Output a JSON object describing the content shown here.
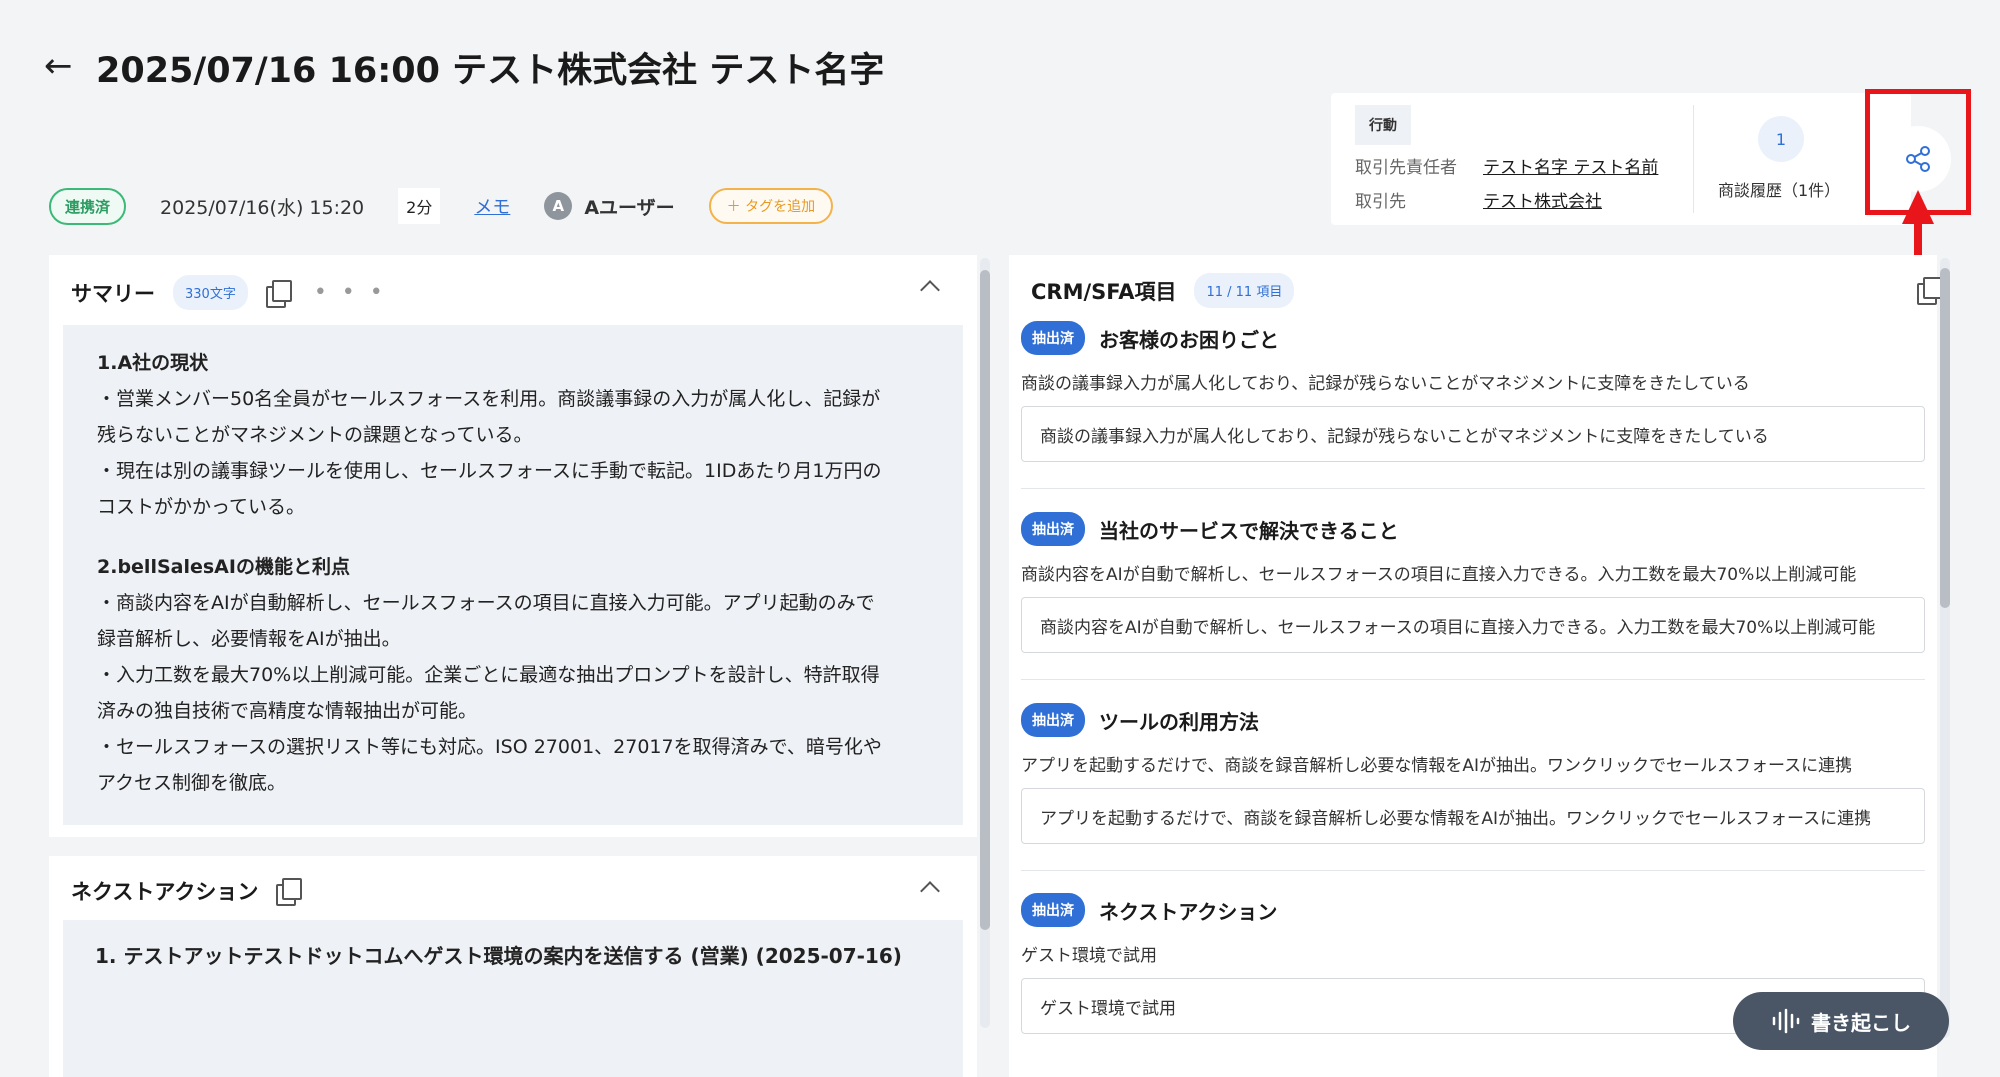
{
  "header": {
    "back_icon": "arrow-left-icon",
    "title": "2025/07/16 16:00 テスト株式会社 テスト名字"
  },
  "meta": {
    "status": "連携済",
    "datetime": "2025/07/16(水) 15:20",
    "duration": "2分",
    "memo": "メモ",
    "avatar_initial": "A",
    "user": "Aユーザー",
    "add_tag": "＋ タグを追加"
  },
  "info": {
    "action_label": "行動",
    "contact_key": "取引先責任者",
    "contact_value": "テスト名字 テスト名前",
    "account_key": "取引先",
    "account_value": "テスト株式会社",
    "history_count": "1",
    "history_label": "商談履歴（1件）"
  },
  "summary": {
    "title": "サマリー",
    "char_count": "330文字",
    "dots": "• • •",
    "sections": [
      {
        "heading": "1.A社の現状",
        "lines": [
          "・営業メンバー50名全員がセールスフォースを利用。商談議事録の入力が属人化し、記録が",
          "残らないことがマネジメントの課題となっている。",
          "・現在は別の議事録ツールを使用し、セールスフォースに手動で転記。1IDあたり月1万円の",
          "コストがかかっている。"
        ]
      },
      {
        "heading": "2.bellSalesAIの機能と利点",
        "lines": [
          "・商談内容をAIが自動解析し、セールスフォースの項目に直接入力可能。アプリ起動のみで",
          "録音解析し、必要情報をAIが抽出。",
          "・入力工数を最大70%以上削減可能。企業ごとに最適な抽出プロンプトを設計し、特許取得",
          "済みの独自技術で高精度な情報抽出が可能。",
          "・セールスフォースの選択リスト等にも対応。ISO 27001、27017を取得済みで、暗号化や",
          "アクセス制御を徹底。"
        ]
      }
    ]
  },
  "next_action": {
    "title": "ネクストアクション",
    "item": "1. テストアットテストドットコムへゲスト環境の案内を送信する (営業) (2025-07-16)"
  },
  "crm": {
    "title": "CRM/SFA項目",
    "count": "11 / 11 項目",
    "items": [
      {
        "chip": "抽出済",
        "label": "お客様のお困りごと",
        "desc": "商談の議事録入力が属人化しており、記録が残らないことがマネジメントに支障をきたしている",
        "value": "商談の議事録入力が属人化しており、記録が残らないことがマネジメントに支障をきたしている"
      },
      {
        "chip": "抽出済",
        "label": "当社のサービスで解決できること",
        "desc": "商談内容をAIが自動で解析し、セールスフォースの項目に直接入力できる。入力工数を最大70%以上削減可能",
        "value": "商談内容をAIが自動で解析し、セールスフォースの項目に直接入力できる。入力工数を最大70%以上削減可能"
      },
      {
        "chip": "抽出済",
        "label": "ツールの利用方法",
        "desc": "アプリを起動するだけで、商談を録音解析し必要な情報をAIが抽出。ワンクリックでセールスフォースに連携",
        "value": "アプリを起動するだけで、商談を録音解析し必要な情報をAIが抽出。ワンクリックでセールスフォースに連携"
      },
      {
        "chip": "抽出済",
        "label": "ネクストアクション",
        "desc": "ゲスト環境で試用",
        "value": "ゲスト環境で試用"
      }
    ]
  },
  "transcribe": {
    "label": "書き起こし"
  },
  "colors": {
    "accent": "#2f6fd6",
    "highlight": "#e8161b",
    "status_green": "#3cb878",
    "tag_orange": "#f3b24a"
  }
}
